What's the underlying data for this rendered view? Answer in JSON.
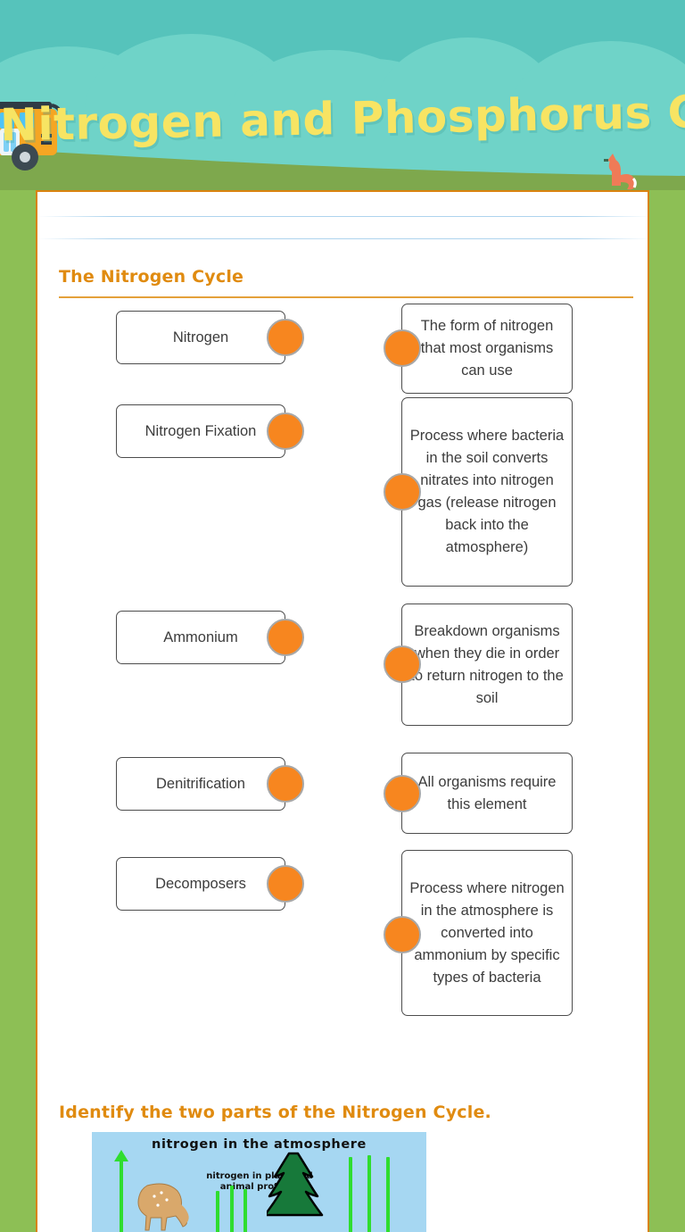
{
  "banner": {
    "title": "Nitrogen and Phosphorus Cycles",
    "colors": {
      "sky": "#56c3bb",
      "cloud": "#6fd3c8",
      "grass": "#7ea84d",
      "title": "#f7e463"
    },
    "decorations": [
      "school-bus",
      "fox"
    ]
  },
  "worksheet": {
    "border_color": "#d98310",
    "accent_color": "#e08b10",
    "dot_color": "#f7861f"
  },
  "sections": [
    {
      "id": "nitrogen-cycle",
      "heading": "The Nitrogen Cycle",
      "type": "matching",
      "left_column": [
        {
          "label": "Nitrogen"
        },
        {
          "label": "Nitrogen Fixation"
        },
        {
          "label": "Ammonium"
        },
        {
          "label": "Denitrification"
        },
        {
          "label": "Decomposers"
        }
      ],
      "right_column": [
        {
          "label": "The form of nitrogen that most organisms can use"
        },
        {
          "label": "Process where bacteria in the soil converts nitrates into nitrogen gas (release nitrogen back into the atmosphere)"
        },
        {
          "label": "Breakdown organisms when they die in order to return nitrogen to the soil"
        },
        {
          "label": "All organisms require this element"
        },
        {
          "label": "Process where nitrogen in the atmosphere is converted into ammonium by specific types of bacteria"
        }
      ]
    },
    {
      "id": "identify-parts",
      "heading": "Identify the two parts of the Nitrogen Cycle.",
      "type": "image-question",
      "image": {
        "name": "nitrogen-cycle-diagram",
        "background": "#a6d7f2",
        "caption_top": "nitrogen in the atmosphere",
        "caption_inner": "nitrogen in plant and animal proteins",
        "elements": [
          "up-arrow",
          "deer",
          "pine-tree",
          "grass-blades"
        ]
      }
    }
  ]
}
